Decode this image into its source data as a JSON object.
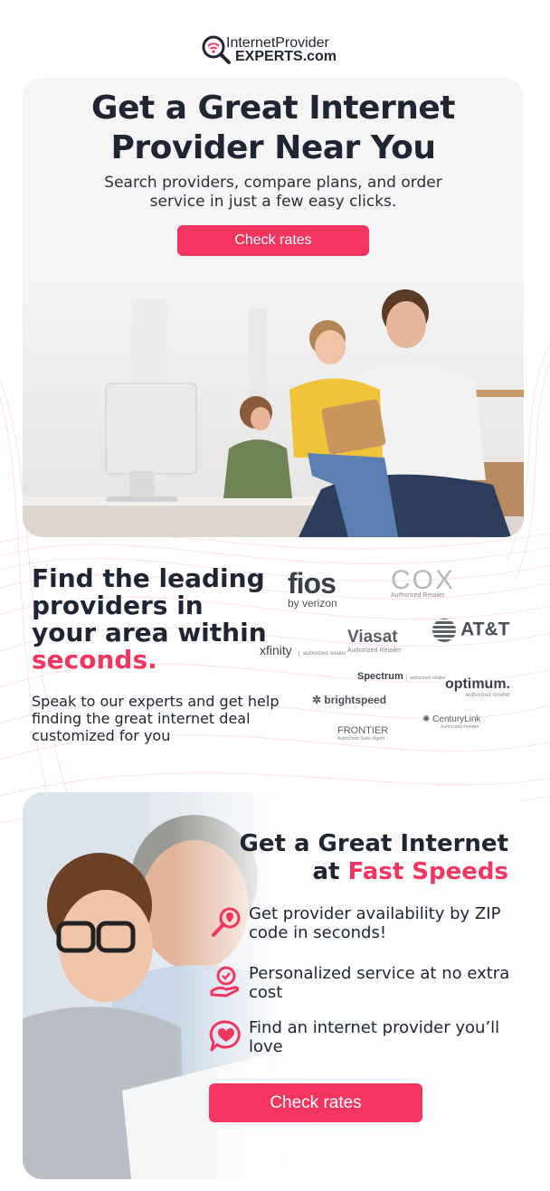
{
  "brand": {
    "line1": "InternetProvider",
    "line2": "EXPERTS.com"
  },
  "hero": {
    "title": "Get a Great Internet Provider Near You",
    "subtitle": "Search providers, compare plans, and order service in just a few easy clicks.",
    "cta": "Check rates"
  },
  "providers_section": {
    "title_main": "Find the leading providers in your area within",
    "title_accent": "seconds.",
    "description": "Speak to our experts and get help finding the great internet deal customized for you",
    "logos": [
      {
        "name": "fios",
        "tag": "by verizon"
      },
      {
        "name": "COX",
        "tag": "Authorized Retailer"
      },
      {
        "name": "Viasat",
        "tag": "Authorized Retailer"
      },
      {
        "name": "AT&T",
        "tag": ""
      },
      {
        "name": "xfinity",
        "tag": "authorized retailer"
      },
      {
        "name": "Spectrum",
        "tag": "authorized retailer"
      },
      {
        "name": "optimum.",
        "tag": "authorized reseller"
      },
      {
        "name": "brightspeed",
        "tag": ""
      },
      {
        "name": "FRONTIER",
        "tag": "Authorized Sales Agent"
      },
      {
        "name": "CenturyLink",
        "tag": "Authorized Retailer"
      }
    ]
  },
  "features": {
    "title_line1": "Get a Great Internet",
    "title_at": "at",
    "title_accent": "Fast Speeds",
    "items": [
      {
        "text": "Get provider availability by ZIP code in seconds!",
        "icon": "search-location-icon"
      },
      {
        "text": "Personalized service at no extra cost",
        "icon": "badge-hand-icon"
      },
      {
        "text": "Find an internet provider you’ll love",
        "icon": "heart-chat-icon"
      }
    ],
    "cta": "Check rates"
  },
  "colors": {
    "accent": "#f2365f",
    "text": "#1f2533"
  }
}
